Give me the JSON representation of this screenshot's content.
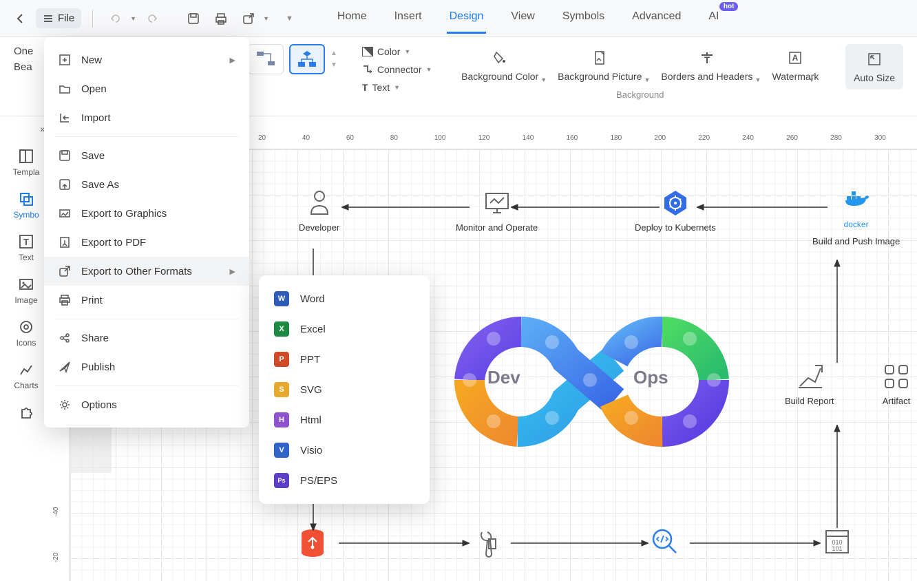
{
  "toolbar": {
    "file_label": "File"
  },
  "tabs": [
    "Home",
    "Insert",
    "Design",
    "View",
    "Symbols",
    "Advanced",
    "AI"
  ],
  "tabs_active": 2,
  "hot_badge": "hot",
  "title_partial_top": "One",
  "title_partial_bottom": "Bea",
  "ribbon": {
    "color": "Color",
    "connector": "Connector",
    "text": "Text",
    "bg_color": "Background Color",
    "bg_picture": "Background Picture",
    "borders": "Borders and Headers",
    "watermark": "Watermark",
    "auto_size": "Auto Size",
    "background_section": "Background"
  },
  "sidebar": {
    "templates": "Templa",
    "symbols": "Symbo",
    "text": "Text",
    "images": "Image",
    "icons": "Icons",
    "charts": "Charts"
  },
  "ruler_h": [
    "20",
    "40",
    "60",
    "80",
    "100",
    "120",
    "140",
    "160",
    "180",
    "200",
    "220",
    "240",
    "260",
    "280",
    "300"
  ],
  "ruler_v": [
    "-40",
    "-20"
  ],
  "file_menu": {
    "new": "New",
    "open": "Open",
    "import": "Import",
    "save": "Save",
    "save_as": "Save As",
    "export_graphics": "Export to Graphics",
    "export_pdf": "Export to PDF",
    "export_other": "Export to Other Formats",
    "print": "Print",
    "share": "Share",
    "publish": "Publish",
    "options": "Options"
  },
  "export_submenu": [
    {
      "label": "Word",
      "bg": "#2e5db8",
      "letter": "W"
    },
    {
      "label": "Excel",
      "bg": "#1d8a44",
      "letter": "X"
    },
    {
      "label": "PPT",
      "bg": "#d14a28",
      "letter": "P"
    },
    {
      "label": "SVG",
      "bg": "#e6a92c",
      "letter": "S"
    },
    {
      "label": "Html",
      "bg": "#8e52cf",
      "letter": "H"
    },
    {
      "label": "Visio",
      "bg": "#3064c9",
      "letter": "V"
    },
    {
      "label": "PS/EPS",
      "bg": "#5c3fc4",
      "letter": "Ps"
    }
  ],
  "diagram": {
    "developer": "Developer",
    "monitor": "Monitor and Operate",
    "deploy": "Deploy to Kubernets",
    "build_push": "Build and Push Image",
    "docker": "docker",
    "build_report": "Build Report",
    "artifact": "Artifact",
    "dev": "Dev",
    "ops": "Ops"
  }
}
